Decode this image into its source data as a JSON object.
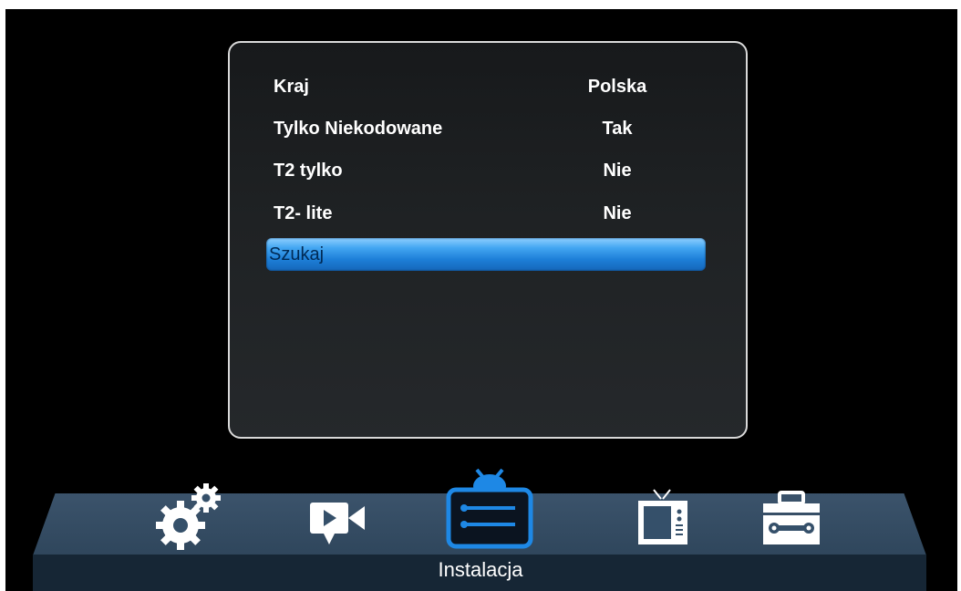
{
  "menu": {
    "rows": [
      {
        "label": "Kraj",
        "value": "Polska"
      },
      {
        "label": "Tylko Niekodowane",
        "value": "Tak"
      },
      {
        "label": "T2 tylko",
        "value": "Nie"
      },
      {
        "label": "T2- lite",
        "value": "Nie"
      }
    ],
    "selected_action": "Szukaj"
  },
  "dock": {
    "active_label": "Instalacja",
    "icons": [
      "gears-icon",
      "video-camera-icon",
      "tv-installation-icon",
      "tv-icon",
      "toolbox-icon"
    ],
    "accent_color": "#1e88e5"
  }
}
